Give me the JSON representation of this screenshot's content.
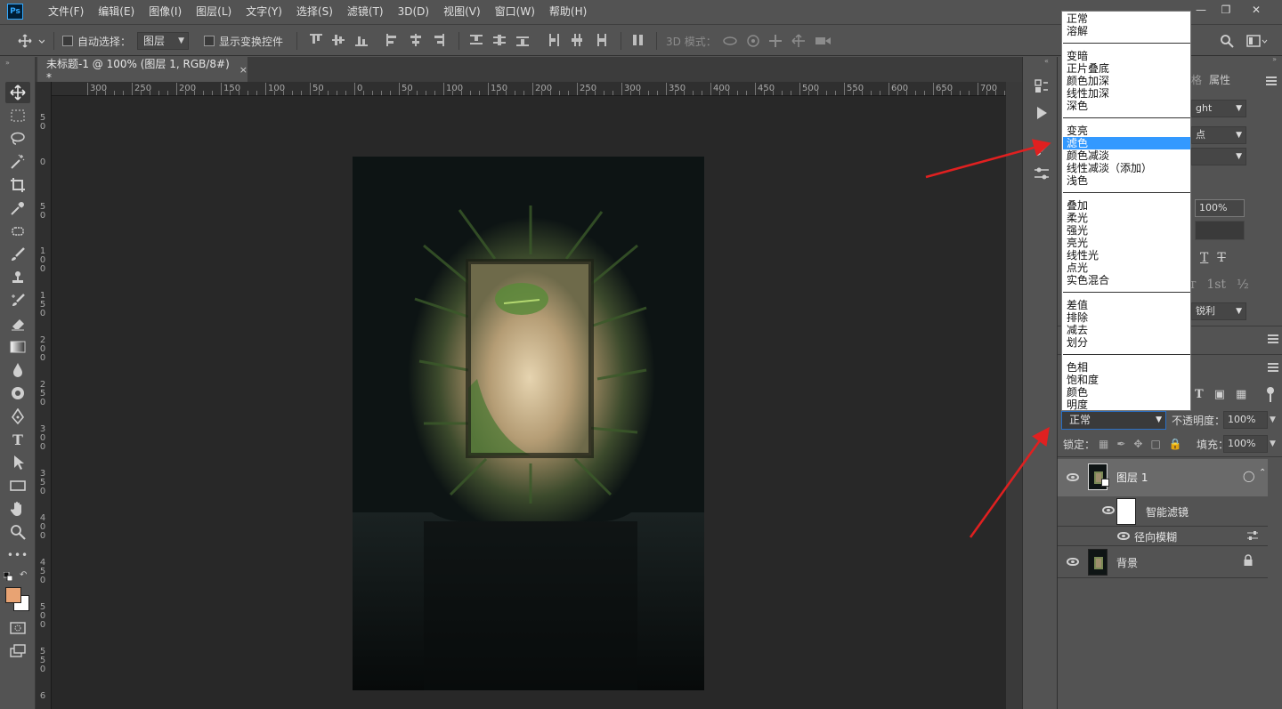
{
  "app": {
    "logo": "Ps"
  },
  "menu": [
    "文件(F)",
    "编辑(E)",
    "图像(I)",
    "图层(L)",
    "文字(Y)",
    "选择(S)",
    "滤镜(T)",
    "3D(D)",
    "视图(V)",
    "窗口(W)",
    "帮助(H)"
  ],
  "options": {
    "auto_select_label": "自动选择：",
    "auto_select_value": "图层",
    "show_transform_label": "显示变换控件",
    "mode_3d_label": "3D 模式："
  },
  "document": {
    "tab_title": "未标题-1 @ 100% (图层 1, RGB/8#) *",
    "close": "×"
  },
  "ruler_top": [
    "300",
    "250",
    "200",
    "150",
    "100",
    "50",
    "0",
    "50",
    "100",
    "150",
    "200",
    "250",
    "300",
    "350",
    "400",
    "450",
    "500",
    "550",
    "600",
    "650",
    "700"
  ],
  "ruler_left": [
    "5\n0",
    "0",
    "5\n0",
    "1\n0\n0",
    "1\n5\n0",
    "2\n0\n0",
    "2\n5\n0",
    "3\n0\n0",
    "3\n5\n0",
    "4\n0\n0",
    "4\n5\n0",
    "5\n0\n0",
    "5\n5\n0",
    "6"
  ],
  "colors": {
    "foreground": "#e8a373",
    "background": "#ffffff",
    "selection": "#3399ff",
    "annotation_arrow": "#e02020"
  },
  "properties_panel": {
    "tab_properties": "属性",
    "font_style_partial": "ght",
    "size_unit_partial": "点",
    "percent": "100%",
    "superscript": "1st",
    "fraction": "½",
    "antialias": "锐利"
  },
  "blend_modes": {
    "groups": [
      [
        "正常",
        "溶解"
      ],
      [
        "变暗",
        "正片叠底",
        "颜色加深",
        "线性加深",
        "深色"
      ],
      [
        "变亮",
        "滤色",
        "颜色减淡",
        "线性减淡（添加）",
        "浅色"
      ],
      [
        "叠加",
        "柔光",
        "强光",
        "亮光",
        "线性光",
        "点光",
        "实色混合"
      ],
      [
        "差值",
        "排除",
        "减去",
        "划分"
      ],
      [
        "色相",
        "饱和度",
        "颜色",
        "明度"
      ]
    ],
    "selected": "滤色"
  },
  "layers_panel": {
    "blend_value": "正常",
    "opacity_label": "不透明度：",
    "opacity_value": "100%",
    "lock_label": "锁定：",
    "fill_label": "填充：",
    "fill_value": "100%",
    "layers": [
      {
        "name": "图层 1"
      },
      {
        "name": "智能滤镜"
      },
      {
        "name": "径向模糊"
      },
      {
        "name": "背景"
      }
    ]
  }
}
